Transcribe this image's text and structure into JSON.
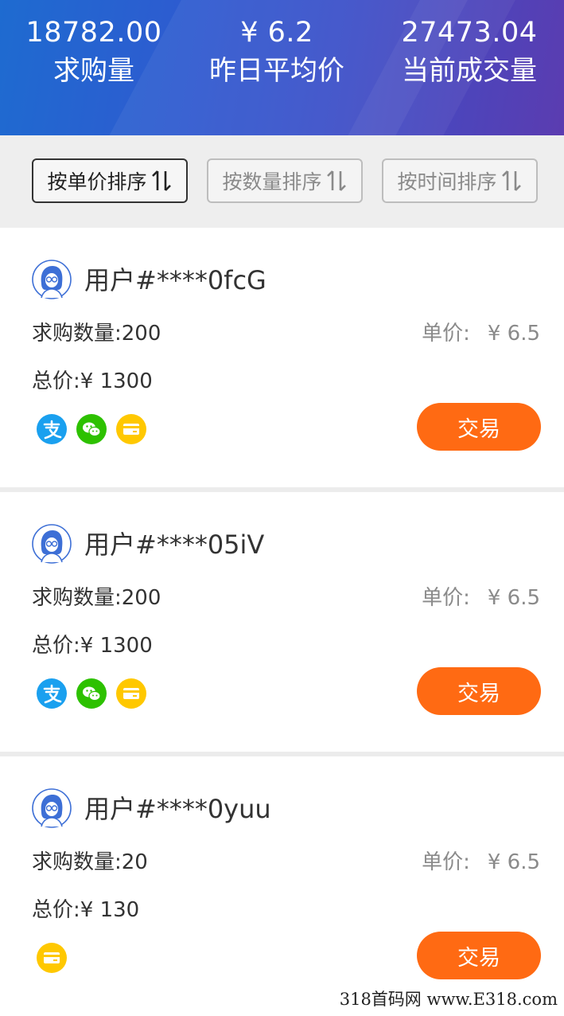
{
  "stats": [
    {
      "value": "18782.00",
      "label": "求购量"
    },
    {
      "value": "¥ 6.2",
      "label": "昨日平均价"
    },
    {
      "value": "27473.04",
      "label": "当前成交量"
    }
  ],
  "sort": {
    "by_price": "按单价排序",
    "by_quantity": "按数量排序",
    "by_time": "按时间排序",
    "active": "by_price"
  },
  "labels": {
    "quantity": "求购数量:",
    "unit_price": "单价:",
    "total": "总价:",
    "trade": "交易"
  },
  "orders": [
    {
      "user": "用户#****0fcG",
      "quantity": "200",
      "unit_price": "¥ 6.5",
      "total": "¥ 1300",
      "payment_methods": [
        "alipay-icon",
        "wechat-pay-icon",
        "bank-card-icon"
      ]
    },
    {
      "user": "用户#****05iV",
      "quantity": "200",
      "unit_price": "¥ 6.5",
      "total": "¥ 1300",
      "payment_methods": [
        "alipay-icon",
        "wechat-pay-icon",
        "bank-card-icon"
      ]
    },
    {
      "user": "用户#****0yuu",
      "quantity": "20",
      "unit_price": "¥ 6.5",
      "total": "¥ 130",
      "payment_methods": [
        "bank-card-icon"
      ]
    }
  ],
  "watermark": "318首码网 www.E318.com",
  "colors": {
    "header_start": "#1e6bd0",
    "header_end": "#5b3cb0",
    "trade_button": "#ff6a13",
    "alipay": "#1aa0ef",
    "wechat": "#2dc100",
    "bank_card": "#ffc800"
  }
}
